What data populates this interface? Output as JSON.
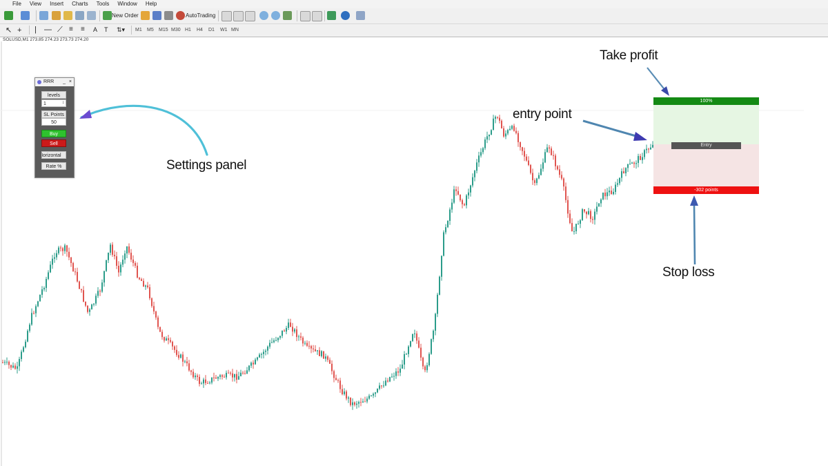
{
  "menu": [
    "File",
    "View",
    "Insert",
    "Charts",
    "Tools",
    "Window",
    "Help"
  ],
  "toolbar": {
    "new_order_label": "New Order",
    "autotrading_label": "AutoTrading",
    "timeframes": [
      "M1",
      "M5",
      "M15",
      "M30",
      "H1",
      "H4",
      "D1",
      "W1",
      "MN"
    ]
  },
  "symbol_bar": "SOLUSD,M1  273.85 274.23 273.73 274.20",
  "panel": {
    "title": "RRR",
    "min_glyph": "_",
    "close_glyph": "×",
    "levels_label": "levels",
    "levels_value": "1",
    "sl_points_label": "SL Points",
    "sl_points_value": "50",
    "buy_label": "Buy",
    "sell_label": "Sell",
    "horizontal_label": "Horizontal",
    "rate_label": "Rate %"
  },
  "zones": {
    "tp_label": "100%",
    "entry_label": "Entry",
    "sl_label": "-302 points",
    "colors": {
      "tp_bar": "#148a14",
      "tp_zone": "#e6f6e3",
      "sl_zone": "#f5e4e4",
      "sl_bar": "#ee1111",
      "entry_bar": "#555555"
    }
  },
  "annotations": {
    "settings_panel": "Settings panel",
    "take_profit": "Take profit",
    "entry_point": "entry point",
    "stop_loss": "Stop loss"
  },
  "candle_colors": {
    "bull": "#2b9c8a",
    "bear": "#e0544f"
  }
}
